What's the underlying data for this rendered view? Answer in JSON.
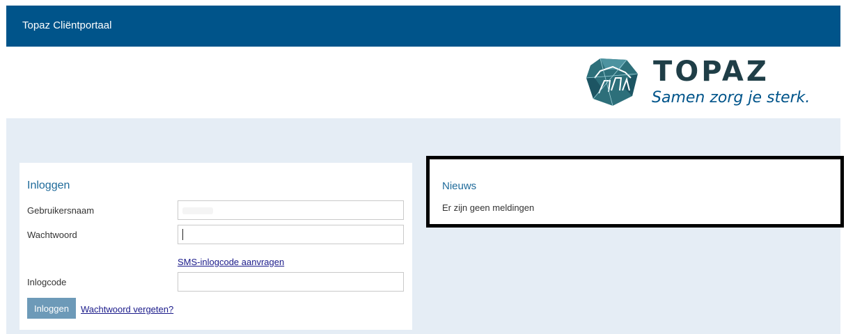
{
  "header": {
    "app_title": "Topaz Cliëntportaal"
  },
  "brand": {
    "logo_icon": "topaz-diamond-logo",
    "name": "TOPAZ",
    "slogan": "Samen zorg je sterk.",
    "colors": {
      "header": "#00548a",
      "wordmark": "#1f3e47",
      "slogan": "#00548a"
    }
  },
  "login": {
    "heading": "Inloggen",
    "username_label": "Gebruikersnaam",
    "username_value": "",
    "password_label": "Wachtwoord",
    "password_value": "",
    "sms_link": "SMS-inlogcode aanvragen",
    "code_label": "Inlogcode",
    "code_value": "",
    "submit_label": "Inloggen",
    "forgot_link": "Wachtwoord vergeten?"
  },
  "news": {
    "heading": "Nieuws",
    "message": "Er zijn geen meldingen"
  }
}
